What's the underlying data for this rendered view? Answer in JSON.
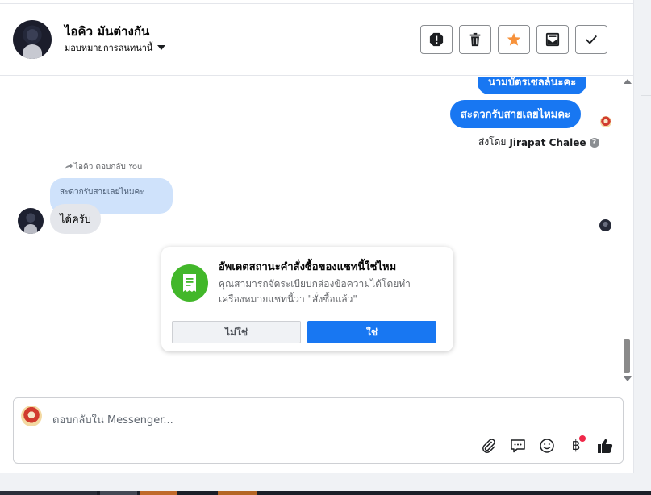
{
  "header": {
    "contact_name": "ไอคิว มันต่างกัน",
    "assign_label": "มอบหมายการสนทนานี้",
    "buttons": [
      {
        "name": "spam-icon"
      },
      {
        "name": "trash-icon"
      },
      {
        "name": "star-icon",
        "color": "#f7923b"
      },
      {
        "name": "mark-unread-icon"
      },
      {
        "name": "check-icon"
      }
    ]
  },
  "conversation": {
    "outgoing_partial": "นามบัตรเซลล์นะคะ",
    "outgoing_message": "สะดวกรับสายเลยไหมคะ",
    "sent_by_prefix": "ส่งโดย",
    "sent_by_name": "Jirapat Chalee",
    "help_glyph": "?",
    "reply_note": "ไอคิว ตอบกลับ You",
    "quoted_text": "สะดวกรับสายเลยไหมคะ",
    "incoming_message": "ได้ครับ"
  },
  "prompt_card": {
    "title": "อัพเดตสถานะคำสั่งซื้อของแชทนี้ใช่ไหม",
    "body": "คุณสามารถจัดระเบียบกล่องข้อความได้โดยทำเครื่องหมายแชทนี้ว่า \"สั่งซื้อแล้ว\"",
    "no_label": "ไม่ใช่",
    "yes_label": "ใช่",
    "icon": "receipt-icon",
    "icon_bg": "#42b72a"
  },
  "composer": {
    "placeholder": "ตอบกลับใน Messenger...",
    "tools": [
      "attachment-icon",
      "saved-replies-icon",
      "emoji-icon",
      "baht-payment-icon",
      "thumbs-up-icon"
    ],
    "baht_symbol": "฿"
  },
  "colors": {
    "accent": "#1877f2",
    "notification_dot": "#f02849"
  }
}
